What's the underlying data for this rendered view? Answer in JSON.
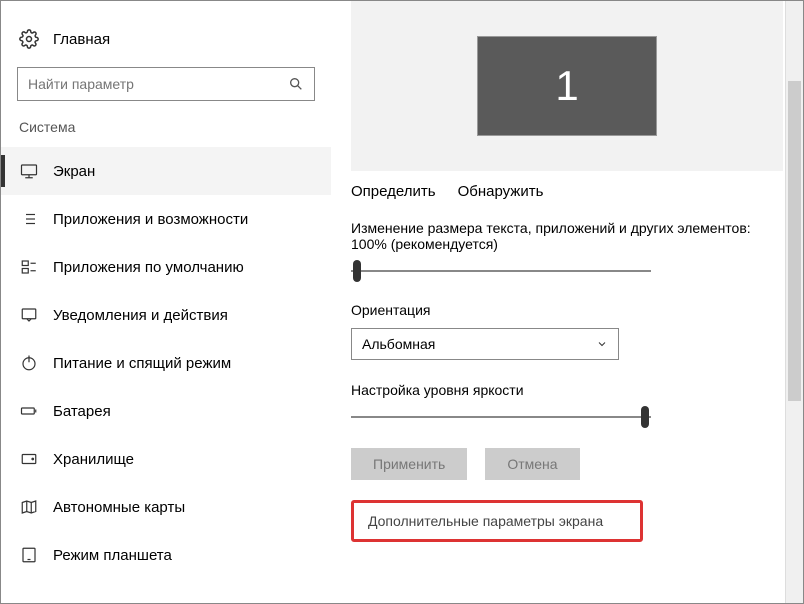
{
  "home": {
    "label": "Главная"
  },
  "search": {
    "placeholder": "Найти параметр"
  },
  "category": "Система",
  "nav": {
    "items": [
      {
        "label": "Экран",
        "icon": "monitor-icon",
        "active": true
      },
      {
        "label": "Приложения и возможности",
        "icon": "list-icon"
      },
      {
        "label": "Приложения по умолчанию",
        "icon": "defaults-icon"
      },
      {
        "label": "Уведомления и действия",
        "icon": "notification-icon"
      },
      {
        "label": "Питание и спящий режим",
        "icon": "power-icon"
      },
      {
        "label": "Батарея",
        "icon": "battery-icon"
      },
      {
        "label": "Хранилище",
        "icon": "storage-icon"
      },
      {
        "label": "Автономные карты",
        "icon": "maps-icon"
      },
      {
        "label": "Режим планшета",
        "icon": "tablet-icon"
      }
    ]
  },
  "display": {
    "monitor_number": "1",
    "identify": "Определить",
    "detect": "Обнаружить",
    "scale_label": "Изменение размера текста, приложений и других элементов: 100% (рекомендуется)",
    "scale_value_percent": 0,
    "orientation_label": "Ориентация",
    "orientation_value": "Альбомная",
    "brightness_label": "Настройка уровня яркости",
    "brightness_value_percent": 100,
    "apply": "Применить",
    "cancel": "Отмена",
    "advanced_link": "Дополнительные параметры экрана"
  }
}
